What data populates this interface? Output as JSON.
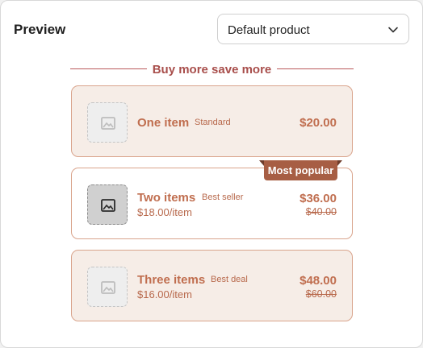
{
  "header": {
    "title": "Preview",
    "select_value": "Default product"
  },
  "offer": {
    "heading": "Buy more save more",
    "badge": "Most popular",
    "colors": {
      "accent": "#a84e4b",
      "badge_bg": "#a75e44",
      "card_bg": "#f6ede7",
      "border": "#d9a48c"
    },
    "tiers": [
      {
        "title": "One item",
        "tag": "Standard",
        "per_item": "",
        "price": "$20.00",
        "old_price": "",
        "thumb_icon": "image-icon"
      },
      {
        "title": "Two items",
        "tag": "Best seller",
        "per_item": "$18.00/item",
        "price": "$36.00",
        "old_price": "$40.00",
        "thumb_icon": "image-icon"
      },
      {
        "title": "Three items",
        "tag": "Best deal",
        "per_item": "$16.00/item",
        "price": "$48.00",
        "old_price": "$60.00",
        "thumb_icon": "image-icon"
      }
    ]
  }
}
